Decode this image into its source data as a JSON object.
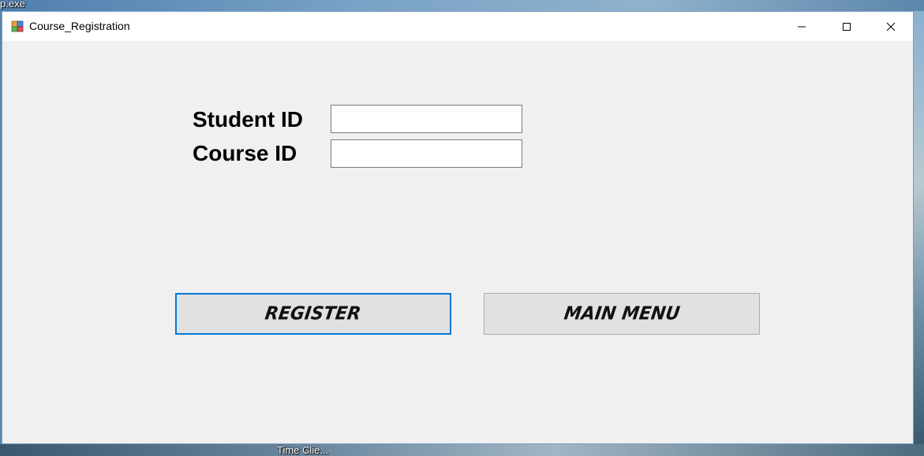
{
  "desktop": {
    "top_label": "p.exe",
    "bottom_label": "Time Clie..."
  },
  "window": {
    "title": "Course_Registration",
    "icon": "winforms-app-icon",
    "controls": [
      "minimize-icon",
      "maximize-icon",
      "close-icon"
    ]
  },
  "form": {
    "student_id_label": "Student ID",
    "student_id_value": "",
    "course_id_label": "Course ID",
    "course_id_value": "",
    "register_label": "REGISTER",
    "main_menu_label": "MAIN MENU"
  },
  "colors": {
    "focus_border": "#0078d7",
    "form_background": "#f0f0f0",
    "button_face": "#e1e1e1"
  }
}
